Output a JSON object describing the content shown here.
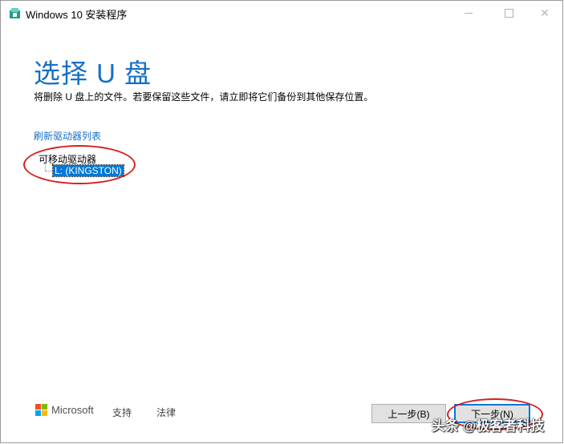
{
  "window": {
    "title": "Windows 10 安装程序",
    "controls": {
      "minimize": "minimize",
      "maximize": "maximize",
      "close": "✕"
    }
  },
  "main": {
    "heading": "选择 U 盘",
    "description": "将删除 U 盘上的文件。若要保留这些文件，请立即将它们备份到其他保存位置。",
    "refresh_link": "刷新驱动器列表",
    "drive_tree": {
      "group_label": "可移动驱动器",
      "items": [
        {
          "label": "L: (KINGSTON)",
          "selected": true
        }
      ]
    }
  },
  "footer": {
    "brand": "Microsoft",
    "support_link": "支持",
    "legal_link": "法律",
    "back_button": "上一步(B)",
    "next_button": "下一步(N)"
  },
  "watermark": "头条 @极客者科技",
  "colors": {
    "accent": "#1570c6",
    "selection": "#0078d7",
    "annotation": "#d42020"
  }
}
